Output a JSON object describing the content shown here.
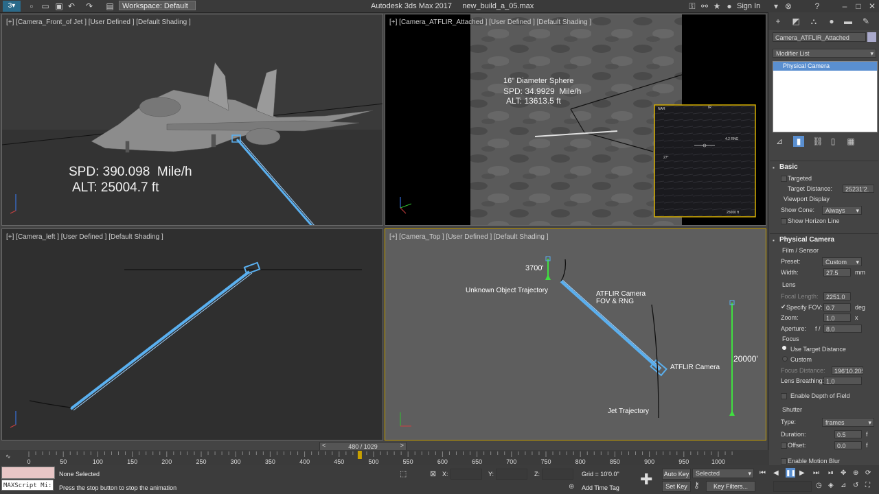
{
  "app": {
    "title": "Autodesk 3ds Max 2017",
    "file": "new_build_a_05.max",
    "workspace": "Workspace: Default",
    "sign_in": "Sign In"
  },
  "viewports": {
    "front": {
      "label": "[+] [Camera_Front_of Jet ] [User Defined ] [Default Shading ]",
      "spd_label": "SPD:",
      "spd_value": "390.098",
      "spd_unit": "Mile/h",
      "alt_label": "ALT:",
      "alt_value": "25004.7 ft"
    },
    "atflir": {
      "label": "[+] [Camera_ATFLIR_Attached ] [User Defined ] [Default Shading ]",
      "object_name": "16\" Diameter Sphere",
      "spd": "SPD: 34.9929  Mile/h",
      "alt": "ALT: 13613.5 ft"
    },
    "left": {
      "label": "[+] [Camera_left ] [User Defined ] [Default Shading ]"
    },
    "top": {
      "label": "[+] [Camera_Top ] [User Defined ] [Default Shading ]",
      "alt_3700": "3700'",
      "unknown_trajectory": "Unknown Object Trajectory",
      "atflir_fov_1": "ATFLIR Camera",
      "atflir_fov_2": "FOV & RNG",
      "atflir_camera": "ATFLIR Camera",
      "alt_20000": "20000'",
      "jet_trajectory": "Jet Trajectory"
    }
  },
  "command_panel": {
    "object_name": "Camera_ATFLIR_Attached",
    "modifier_list": "Modifier List",
    "stack_item": "Physical Camera",
    "basic": {
      "title": "Basic",
      "targeted": "Targeted",
      "target_distance_label": "Target Distance:",
      "target_distance_value": "25231'2.",
      "viewport_display": "Viewport Display",
      "show_cone_label": "Show Cone:",
      "show_cone_value": "Always",
      "show_horizon": "Show Horizon Line"
    },
    "physical": {
      "title": "Physical Camera",
      "film_sensor": "Film / Sensor",
      "preset_label": "Preset:",
      "preset_value": "Custom",
      "width_label": "Width:",
      "width_value": "27.5",
      "width_unit": "mm",
      "lens": "Lens",
      "focal_label": "Focal Length:",
      "focal_value": "2251.0",
      "specify_fov": "Specify FOV:",
      "fov_value": "0.7",
      "fov_unit": "deg",
      "zoom_label": "Zoom:",
      "zoom_value": "1.0",
      "zoom_unit": "x",
      "aperture_label": "Aperture:",
      "aperture_f": "f /",
      "aperture_value": "8.0",
      "focus": "Focus",
      "use_target_distance": "Use Target Distance",
      "custom": "Custom",
      "focus_distance_label": "Focus Distance:",
      "focus_distance_value": "196'10.205",
      "lens_breathing_label": "Lens Breathing:",
      "lens_breathing_value": "1.0",
      "enable_dof": "Enable Depth of Field",
      "shutter": "Shutter",
      "type_label": "Type:",
      "type_value": "frames",
      "duration_label": "Duration:",
      "duration_value": "0.5",
      "duration_unit": "f",
      "offset_label": "Offset:",
      "offset_value": "0.0",
      "offset_unit": "f",
      "enable_motion_blur": "Enable Motion Blur"
    }
  },
  "timeline": {
    "frame_counter": "480 / 1029",
    "ticks": [
      "0",
      "50",
      "100",
      "150",
      "200",
      "250",
      "300",
      "350",
      "400",
      "450",
      "500",
      "550",
      "600",
      "650",
      "700",
      "750",
      "800",
      "850",
      "900",
      "950",
      "1000"
    ],
    "current_frame": 480,
    "total_frames": 1029
  },
  "status": {
    "maxscript": "MAXScript Mi:",
    "selection": "None Selected",
    "prompt": "Press the stop button to stop the animation",
    "x_label": "X:",
    "y_label": "Y:",
    "z_label": "Z:",
    "grid": "Grid = 10'0.0\"",
    "add_time_tag": "Add Time Tag",
    "auto_key": "Auto Key",
    "selected": "Selected",
    "set_key": "Set Key",
    "key_filters": "Key Filters..."
  }
}
